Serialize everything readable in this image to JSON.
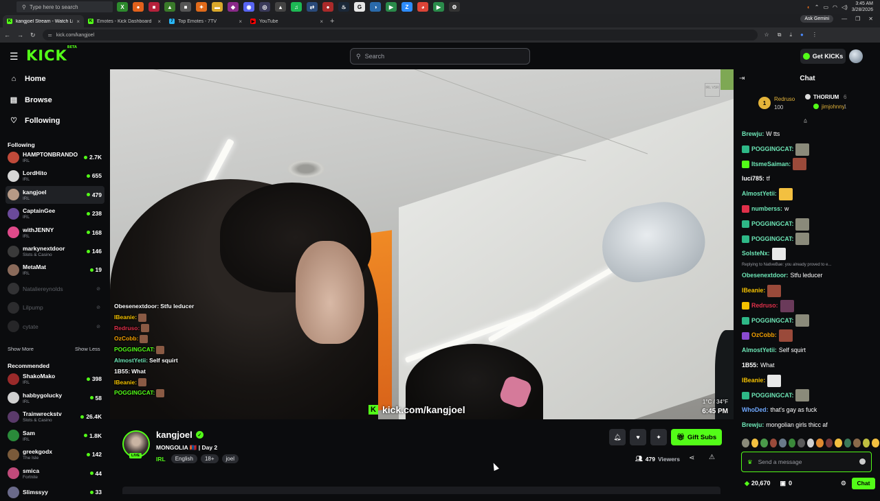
{
  "os": {
    "search_placeholder": "Type here to search",
    "clock_time": "3:45 AM",
    "clock_date": "3/28/2026"
  },
  "browser": {
    "tabs": [
      {
        "title": "kangjoel Stream - Watch Live",
        "color": "#53fc18",
        "letter": "K",
        "active": true
      },
      {
        "title": "Emotes - Kick Dashboard",
        "color": "#53fc18",
        "letter": "K",
        "active": false
      },
      {
        "title": "Top Emotes - 7TV",
        "color": "#29b6f6",
        "letter": "7",
        "active": false
      },
      {
        "title": "YouTube",
        "color": "#ff0000",
        "letter": "▶",
        "active": false
      }
    ],
    "new_tab": "+",
    "ask_label": "Ask Gemini",
    "url": "kick.com/kangjoel"
  },
  "header": {
    "logo": "KICK",
    "logo_beta": "BETA",
    "search_placeholder": "Search",
    "get_kicks_label": "Get KICKs"
  },
  "sidebar": {
    "nav": [
      {
        "label": "Home",
        "icon": "home-icon",
        "glyph": "⌂"
      },
      {
        "label": "Browse",
        "icon": "browse-icon",
        "glyph": "▤"
      },
      {
        "label": "Following",
        "icon": "heart-icon",
        "glyph": "♡"
      }
    ],
    "following_title": "Following",
    "following": [
      {
        "name": "HAMPTONBRANDO",
        "category": "IRL",
        "viewers": "2.7K",
        "color": "#c04a3a",
        "live": true
      },
      {
        "name": "LordHito",
        "category": "IRL",
        "viewers": "655",
        "color": "#d6d6d6",
        "live": true
      },
      {
        "name": "kangjoel",
        "category": "IRL",
        "viewers": "479",
        "color": "#b79a86",
        "live": true,
        "selected": true
      },
      {
        "name": "CaptainGee",
        "category": "IRL",
        "viewers": "238",
        "color": "#6a4a9a",
        "live": true
      },
      {
        "name": "withJENNY",
        "category": "IRL",
        "viewers": "168",
        "color": "#e04a8a",
        "live": true
      },
      {
        "name": "markynextdoor",
        "category": "Slots & Casino",
        "viewers": "146",
        "color": "#3a3a3a",
        "live": true
      },
      {
        "name": "MetaMat",
        "category": "IRL",
        "viewers": "19",
        "color": "#8a6a5a",
        "live": true
      },
      {
        "name": "Nataliereynolds",
        "category": "",
        "viewers": "",
        "color": "#7a7a7a",
        "live": false
      },
      {
        "name": "Lilpump",
        "category": "",
        "viewers": "",
        "color": "#6a6a6a",
        "live": false
      },
      {
        "name": "cytate",
        "category": "",
        "viewers": "",
        "color": "#5a5a5a",
        "live": false
      }
    ],
    "show_more": "Show More",
    "show_less": "Show Less",
    "recommended_title": "Recommended",
    "recommended": [
      {
        "name": "ShakoMako",
        "category": "IRL",
        "viewers": "398",
        "color": "#9a2a2a"
      },
      {
        "name": "habbygolucky",
        "category": "IRL",
        "viewers": "58",
        "color": "#d0d0d0"
      },
      {
        "name": "Trainwreckstv",
        "category": "Slots & Casino",
        "viewers": "26.4K",
        "color": "#5a3a6a"
      },
      {
        "name": "Sam",
        "category": "IRL",
        "viewers": "1.8K",
        "color": "#2a8a3a"
      },
      {
        "name": "greekgodx",
        "category": "The Isle",
        "viewers": "142",
        "color": "#7a5a3a"
      },
      {
        "name": "smica",
        "category": "Fortnite",
        "viewers": "44",
        "color": "#c04a7a"
      },
      {
        "name": "Slimssyy",
        "category": "",
        "viewers": "33",
        "color": "#6a6a8a"
      }
    ],
    "offline_glyph": "⊘"
  },
  "video": {
    "watermark": "IRL VSR",
    "overlay_chat": [
      {
        "user": "Obesenextdoor:",
        "text": "Stfu leducer",
        "color": "#ffffff"
      },
      {
        "user": "IBeanie:",
        "text": "",
        "color": "#f3c000",
        "emote": true
      },
      {
        "user": "Redruso:",
        "text": "",
        "color": "#e0304a",
        "emote": true
      },
      {
        "user": "OzCobb:",
        "text": "",
        "color": "#f3a000",
        "emote": true
      },
      {
        "user": "POGGINGCAT:",
        "text": "",
        "color": "#53fc18",
        "emote": true
      },
      {
        "user": "AlmostYetii:",
        "text": "Self squirt",
        "color": "#6ee7b7"
      },
      {
        "user": "1B55:",
        "text": "What",
        "color": "#ffffff"
      },
      {
        "user": "IBeanie:",
        "text": "",
        "color": "#f3c000",
        "emote": true
      },
      {
        "user": "POGGINGCAT:",
        "text": "",
        "color": "#53fc18",
        "emote": true
      }
    ],
    "url_overlay": "kick.com/kangjoel",
    "temperature": "1°C / 34°F",
    "local_time": "6:45 PM"
  },
  "stream": {
    "live_badge": "LIVE",
    "streamer": "kangjoel",
    "title": "MONGOLIA 🇲🇳 | Day 2",
    "category": "IRL",
    "tags": [
      "English",
      "18+",
      "joel"
    ],
    "gift_subs_label": "Gift Subs",
    "viewers_count": "479",
    "viewers_label": "Viewers"
  },
  "chat": {
    "title": "Chat",
    "leaderboard": [
      {
        "rank": "1",
        "name": "Redruso",
        "value": "100"
      },
      {
        "name": "THORIUM",
        "value": "6"
      },
      {
        "name": "jimjohnny",
        "value": "1"
      }
    ],
    "messages": [
      {
        "user": "Brewju:",
        "text": "W tts",
        "color": "#6ee7b7"
      },
      {
        "user": "POGGINGCAT:",
        "text": "",
        "color": "#6ee7b7",
        "emote": "#8a8a7a",
        "badge": "#2eb887"
      },
      {
        "user": "ItsmeSaiman:",
        "text": "",
        "color": "#6ee7b7",
        "emote": "#9a4a3a",
        "badge": "#53fc18"
      },
      {
        "user": "luci785:",
        "text": "tf",
        "color": "#ffffff"
      },
      {
        "user": "AlmostYetii:",
        "text": "",
        "color": "#6ee7b7",
        "emote": "#f3c040"
      },
      {
        "user": "numberss:",
        "text": "w",
        "color": "#6ee7b7",
        "badge": "#e0304a"
      },
      {
        "user": "POGGINGCAT:",
        "text": "",
        "color": "#6ee7b7",
        "emote": "#8a8a7a",
        "badge": "#2eb887"
      },
      {
        "user": "POGGINGCAT:",
        "text": "",
        "color": "#6ee7b7",
        "emote": "#8a8a7a",
        "badge": "#2eb887"
      },
      {
        "user": "SolsteNx:",
        "text": "",
        "color": "#6ee7b7",
        "emote": "#e8e8e8"
      },
      {
        "reply": "Replying to NativeBae: you already proved to e..."
      },
      {
        "user": "Obesenextdoor:",
        "text": "Stfu leducer",
        "color": "#6ee7b7"
      },
      {
        "user": "IBeanie:",
        "text": "",
        "color": "#f3c000",
        "emote": "#9a4a3a"
      },
      {
        "user": "Redruso:",
        "text": "",
        "color": "#e0304a",
        "emote": "#6a3a5a",
        "badge": "#f3c000"
      },
      {
        "user": "POGGINGCAT:",
        "text": "",
        "color": "#6ee7b7",
        "emote": "#8a8a7a",
        "badge": "#2eb887"
      },
      {
        "user": "OzCobb:",
        "text": "",
        "color": "#f3a000",
        "emote": "#9a4a3a",
        "badge": "#8a4ad0"
      },
      {
        "user": "AlmostYetii:",
        "text": "Self squirt",
        "color": "#6ee7b7"
      },
      {
        "user": "1B55:",
        "text": "What",
        "color": "#ffffff"
      },
      {
        "user": "IBeanie:",
        "text": "",
        "color": "#f3c000",
        "emote": "#e8e8e8"
      },
      {
        "user": "POGGINGCAT:",
        "text": "",
        "color": "#6ee7b7",
        "emote": "#8a8a7a",
        "badge": "#2eb887"
      },
      {
        "user": "WhoDed:",
        "text": "that's gay as fuck",
        "color": "#6fa8ff"
      },
      {
        "user": "Brewju:",
        "text": "mongolian girls thicc af",
        "color": "#6ee7b7"
      }
    ],
    "emote_strip": [
      "#8a8a7a",
      "#f3c040",
      "#4a9a4a",
      "#9a4a3a",
      "#6a7a8a",
      "#3a8a3a",
      "#5a5a5a",
      "#d0d0d0",
      "#e08a30",
      "#7a3a3a",
      "#f3c040",
      "#3a7a5a",
      "#8a6a4a",
      "#c0c040",
      "#f3c040"
    ],
    "input_placeholder": "Send a message",
    "kicks_balance": "20,670",
    "subs_count": "0",
    "chat_button": "Chat"
  },
  "colors": {
    "brand": "#53fc18",
    "background": "#0b0c0e"
  }
}
